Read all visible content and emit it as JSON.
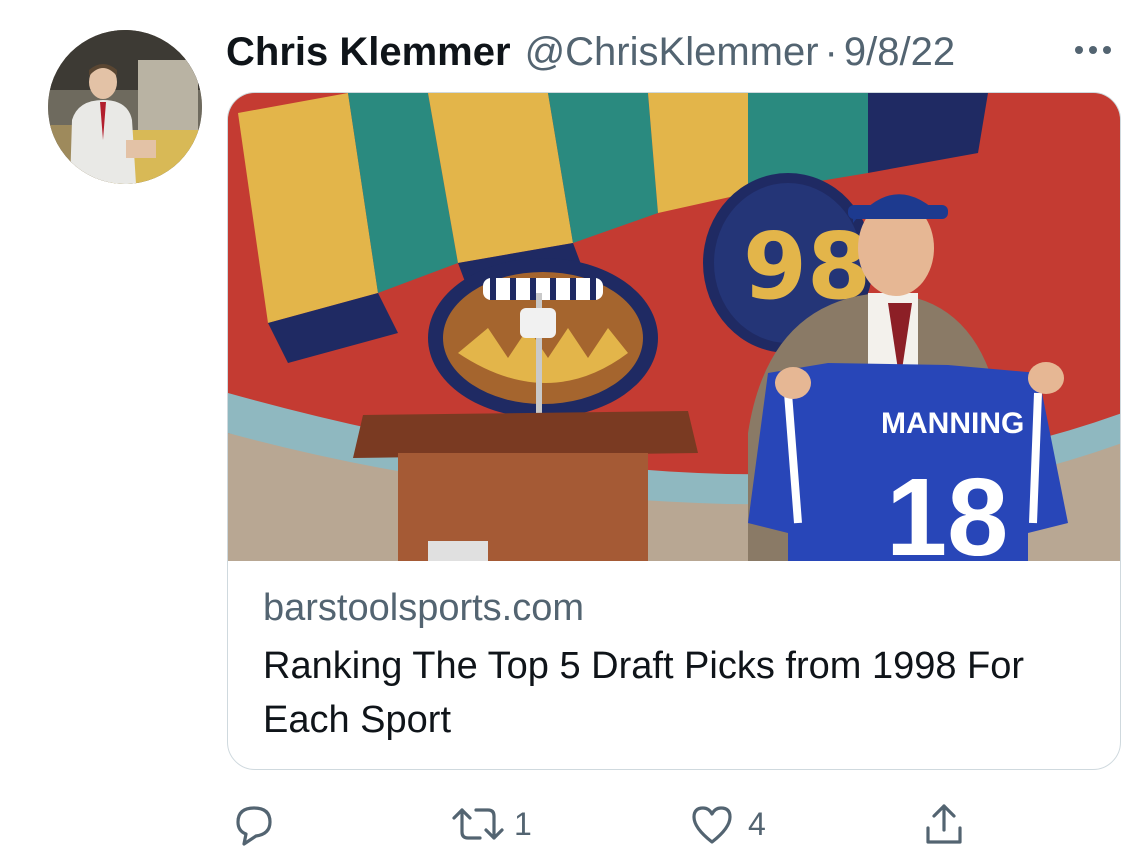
{
  "tweet": {
    "author": {
      "display_name": "Chris Klemmer",
      "handle": "@ChrisKlemmer",
      "avatar_icon": "profile-photo"
    },
    "separator": "·",
    "date": "9/8/22",
    "more_icon": "ellipsis-icon",
    "card": {
      "image": {
        "jersey_name": "MANNING",
        "jersey_number": "18",
        "backdrop_number": "98"
      },
      "domain": "barstoolsports.com",
      "title": "Ranking The Top 5 Draft Picks from 1998 For Each Sport"
    },
    "actions": {
      "reply": {
        "icon": "reply-icon",
        "count": ""
      },
      "retweet": {
        "icon": "retweet-icon",
        "count": "1"
      },
      "like": {
        "icon": "heart-icon",
        "count": "4"
      },
      "share": {
        "icon": "share-icon",
        "count": ""
      }
    }
  },
  "colors": {
    "text_primary": "#0f1419",
    "text_secondary": "#536471",
    "border": "#cfd9de"
  }
}
